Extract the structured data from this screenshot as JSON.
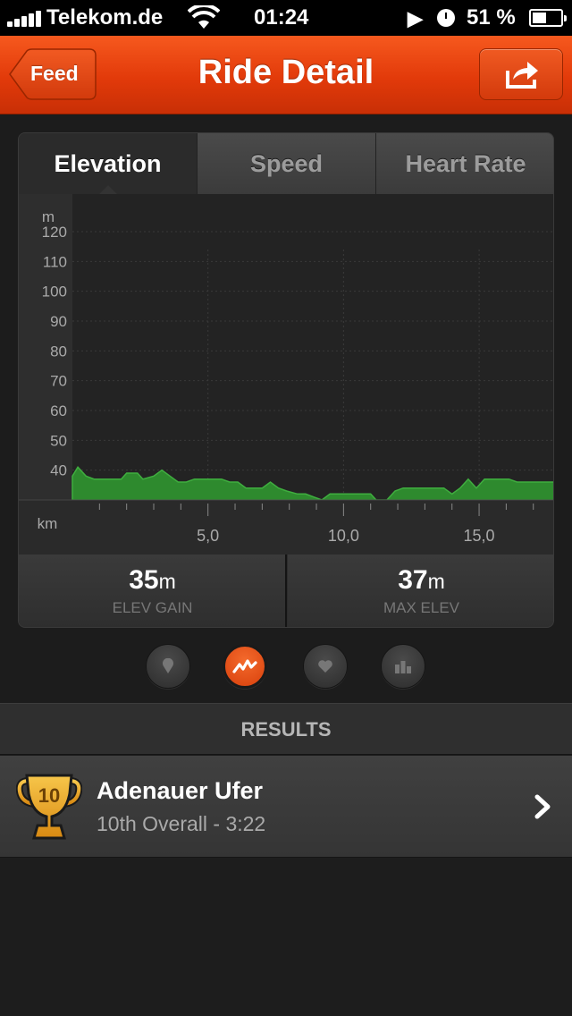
{
  "status_bar": {
    "carrier": "Telekom.de",
    "time": "01:24",
    "battery_percent": "51 %",
    "battery_level": 0.51
  },
  "nav": {
    "title": "Ride Detail",
    "back_label": "Feed"
  },
  "tabs": [
    {
      "label": "Elevation",
      "active": true
    },
    {
      "label": "Speed",
      "active": false
    },
    {
      "label": "Heart Rate",
      "active": false
    }
  ],
  "chart_data": {
    "type": "area",
    "y_unit": "m",
    "x_unit": "km",
    "y_ticks": [
      "120",
      "110",
      "100",
      "90",
      "80",
      "70",
      "60",
      "50",
      "40"
    ],
    "x_ticks": [
      "5,0",
      "10,0",
      "15,0"
    ],
    "ylim": [
      30,
      120
    ],
    "xlim": [
      0,
      17.8
    ],
    "grid": true,
    "fill_color": "#2e8a2e",
    "x": [
      0,
      0.2,
      0.5,
      0.8,
      1.2,
      1.8,
      2.0,
      2.4,
      2.6,
      3.0,
      3.3,
      3.6,
      3.9,
      4.2,
      4.5,
      4.8,
      5.1,
      5.5,
      5.8,
      6.1,
      6.4,
      6.8,
      7.0,
      7.3,
      7.6,
      7.9,
      8.3,
      8.6,
      8.9,
      9.2,
      9.5,
      9.8,
      10.1,
      10.4,
      10.7,
      11.0,
      11.3,
      11.6,
      11.9,
      12.2,
      12.5,
      12.8,
      13.1,
      13.4,
      13.7,
      14.0,
      14.3,
      14.6,
      14.9,
      15.2,
      15.5,
      15.8,
      16.1,
      16.4,
      16.7,
      17.0,
      17.3,
      17.8
    ],
    "y": [
      38,
      41,
      38,
      37,
      37,
      37,
      39,
      39,
      37,
      38,
      40,
      38,
      36,
      36,
      37,
      37,
      37,
      37,
      36,
      36,
      34,
      34,
      34,
      36,
      34,
      33,
      32,
      32,
      31,
      30,
      32,
      32,
      32,
      32,
      32,
      32,
      29,
      30,
      33,
      34,
      34,
      34,
      34,
      34,
      34,
      32,
      34,
      37,
      34,
      37,
      37,
      37,
      37,
      36,
      36,
      36,
      36,
      36
    ]
  },
  "stats": [
    {
      "value": "35",
      "unit": "m",
      "label": "ELEV GAIN"
    },
    {
      "value": "37",
      "unit": "m",
      "label": "MAX ELEV"
    }
  ],
  "pager": [
    {
      "icon": "map-pin-icon",
      "active": false
    },
    {
      "icon": "elevation-graph-icon",
      "active": true
    },
    {
      "icon": "heart-icon",
      "active": false
    },
    {
      "icon": "bar-chart-icon",
      "active": false
    }
  ],
  "results": {
    "header": "RESULTS",
    "items": [
      {
        "trophy_rank": "10",
        "name": "Adenauer Ufer",
        "detail": "10th Overall - 3:22"
      }
    ]
  },
  "colors": {
    "accent": "#e8400e",
    "chart_fill": "#2e8a2e",
    "trophy": "#e8a21c"
  }
}
